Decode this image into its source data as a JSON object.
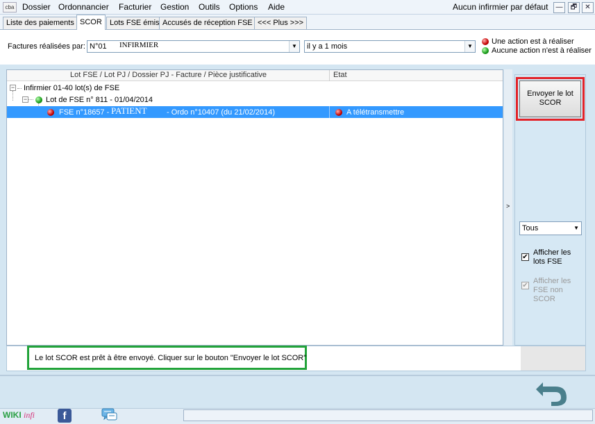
{
  "app": {
    "icon_text": "cba"
  },
  "menu": {
    "items": [
      "Dossier",
      "Ordonnancier",
      "Facturier",
      "Gestion",
      "Outils",
      "Options",
      "Aide"
    ],
    "infirmier_default": "Aucun infirmier par défaut"
  },
  "window_controls": {
    "minimize": "—",
    "restore": "🗗",
    "close": "✕"
  },
  "tabs": [
    {
      "label": "Liste des paiements",
      "active": false
    },
    {
      "label": "SCOR",
      "active": true
    },
    {
      "label": "Lots FSE émis",
      "active": false
    },
    {
      "label": "Accusés de réception FSE",
      "active": false
    },
    {
      "label": "<<< Plus >>>",
      "active": false
    }
  ],
  "filter": {
    "label": "Factures réalisées par:",
    "infirmier_code": "N°01",
    "infirmier_name": "INFIRMIER",
    "period": "il y a 1 mois"
  },
  "legend": {
    "red": "Une action est à réaliser",
    "green": "Aucune action n'est à réaliser",
    "red_color": "#c40000",
    "green_color": "#179a17"
  },
  "tree": {
    "columns": [
      "Lot FSE / Lot PJ / Dossier PJ - Facture / Pièce justificative",
      "Etat"
    ],
    "root": {
      "label": "Infirmier 01-40 lot(s) de FSE",
      "expander": "−"
    },
    "lot": {
      "label": "Lot de FSE n° 811 - 01/04/2014",
      "expander": "−",
      "status": "green"
    },
    "fse": {
      "prefix": "FSE n°18657 -",
      "patient": "PATIENT",
      "suffix": "- Ordo n°10407 (du 21/02/2014)",
      "etat": "A télétransmettre",
      "status": "red"
    }
  },
  "splitter": {
    "arrow": ">"
  },
  "right_panel": {
    "send_button": "Envoyer le lot SCOR",
    "filter_select": "Tous",
    "select_arrow": "▼",
    "afficher_lots": {
      "label": "Afficher les lots FSE",
      "checked": true,
      "mark": "✔"
    },
    "afficher_non_scor": {
      "label": "Afficher les FSE non SCOR",
      "checked": true,
      "disabled": true,
      "mark": "✔"
    }
  },
  "message": "Le lot SCOR est prêt à être envoyé. Cliquer sur le bouton \"Envoyer le lot SCOR\"",
  "footer": {
    "wiki_part1": "WIKI",
    "wiki_part2": "infi",
    "facebook": "f"
  },
  "colors": {
    "selection": "#3399ff",
    "highlight_red": "#e32228",
    "highlight_green": "#22a33a",
    "undo_icon": "#4a7f8c"
  }
}
